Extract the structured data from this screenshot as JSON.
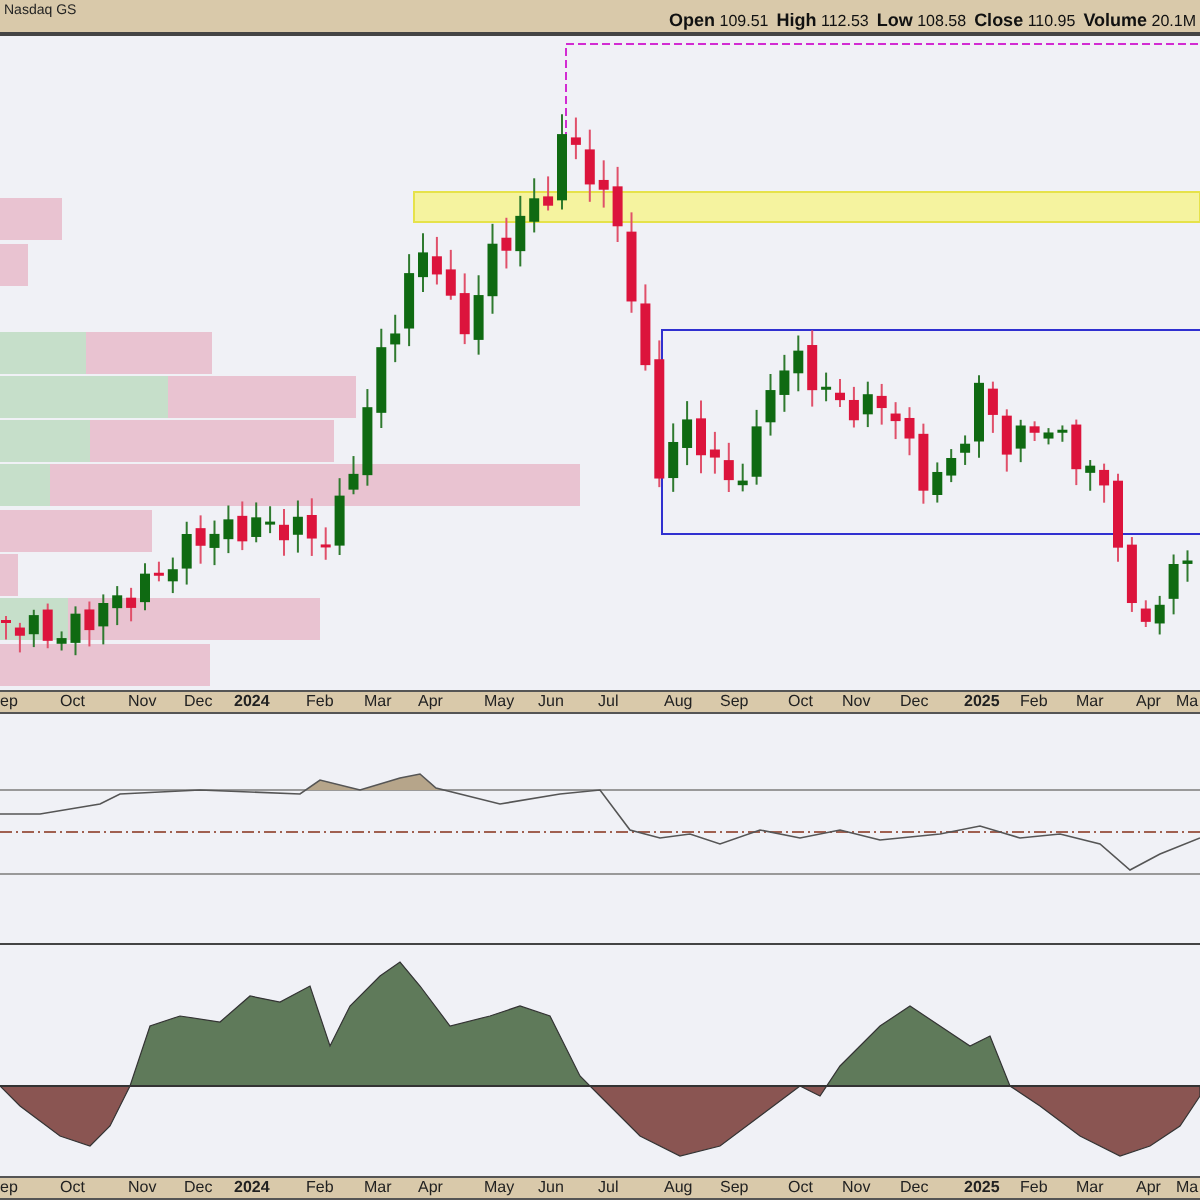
{
  "header": {
    "exchange": "Nasdaq GS",
    "quote": [
      {
        "label": "Open",
        "value": "109.51"
      },
      {
        "label": "High",
        "value": "112.53"
      },
      {
        "label": "Low",
        "value": "108.58"
      },
      {
        "label": "Close",
        "value": "110.95"
      },
      {
        "label": "Volume",
        "value": "20.1M"
      }
    ]
  },
  "price_axis": {
    "labels": [
      {
        "text": "ep",
        "kind": "month"
      },
      {
        "text": "Oct",
        "kind": "month"
      },
      {
        "text": "Nov",
        "kind": "month"
      },
      {
        "text": "Dec",
        "kind": "month"
      },
      {
        "text": "2024",
        "kind": "year"
      },
      {
        "text": "Feb",
        "kind": "month"
      },
      {
        "text": "Mar",
        "kind": "month"
      },
      {
        "text": "Apr",
        "kind": "month"
      },
      {
        "text": "May",
        "kind": "month"
      },
      {
        "text": "Jun",
        "kind": "month"
      },
      {
        "text": "Jul",
        "kind": "month"
      },
      {
        "text": "Aug",
        "kind": "month"
      },
      {
        "text": "Sep",
        "kind": "month"
      },
      {
        "text": "Oct",
        "kind": "month"
      },
      {
        "text": "Nov",
        "kind": "month"
      },
      {
        "text": "Dec",
        "kind": "month"
      },
      {
        "text": "2025",
        "kind": "year"
      },
      {
        "text": "Feb",
        "kind": "month"
      },
      {
        "text": "Mar",
        "kind": "month"
      },
      {
        "text": "Apr",
        "kind": "month"
      },
      {
        "text": "Ma",
        "kind": "month"
      }
    ]
  },
  "indicator_axis": {
    "labels": [
      {
        "text": "ep",
        "kind": "month"
      },
      {
        "text": "Oct",
        "kind": "month"
      },
      {
        "text": "Nov",
        "kind": "month"
      },
      {
        "text": "Dec",
        "kind": "month"
      },
      {
        "text": "2024",
        "kind": "year"
      },
      {
        "text": "Feb",
        "kind": "month"
      },
      {
        "text": "Mar",
        "kind": "month"
      },
      {
        "text": "Apr",
        "kind": "month"
      },
      {
        "text": "May",
        "kind": "month"
      },
      {
        "text": "Jun",
        "kind": "month"
      },
      {
        "text": "Jul",
        "kind": "month"
      },
      {
        "text": "Aug",
        "kind": "month"
      },
      {
        "text": "Sep",
        "kind": "month"
      },
      {
        "text": "Oct",
        "kind": "month"
      },
      {
        "text": "Nov",
        "kind": "month"
      },
      {
        "text": "Dec",
        "kind": "month"
      },
      {
        "text": "2025",
        "kind": "year"
      },
      {
        "text": "Feb",
        "kind": "month"
      },
      {
        "text": "Mar",
        "kind": "month"
      },
      {
        "text": "Apr",
        "kind": "month"
      },
      {
        "text": "Ma",
        "kind": "month"
      }
    ]
  }
}
